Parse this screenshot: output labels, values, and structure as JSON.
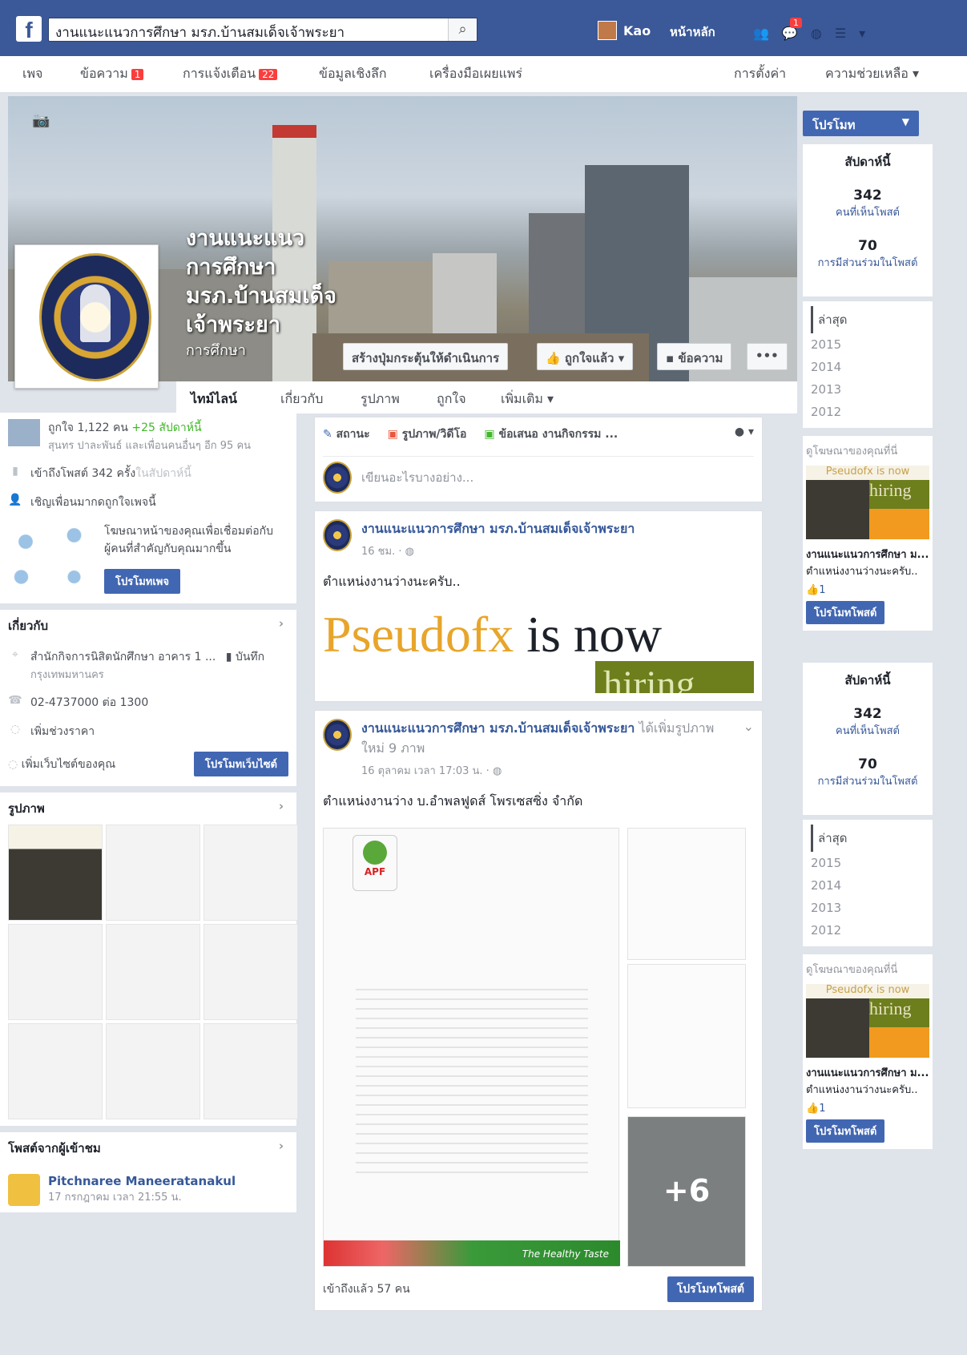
{
  "topbar": {
    "logo": "f",
    "search_value": "งานแนะแนวการศึกษา มรภ.บ้านสมเด็จเจ้าพระยา",
    "user_name": "Kao",
    "home_label": "หน้าหลัก",
    "notif_count": "1"
  },
  "pagenav": {
    "page": "เพจ",
    "messages": "ข้อความ",
    "messages_badge": "1",
    "notifications": "การแจ้งเตือน",
    "notifications_badge": "22",
    "insights": "ข้อมูลเชิงลึก",
    "publishing_tools": "เครื่องมือเผยแพร่",
    "settings": "การตั้งค่า",
    "help": "ความช่วยเหลือ ▾"
  },
  "cover": {
    "title": "งานแนะแนวการศึกษา มรภ.บ้านสมเด็จเจ้าพระยา",
    "category": "การศึกษา",
    "cta_button": "สร้างปุ่มกระตุ้นให้ดำเนินการ",
    "liked_button": "ถูกใจแล้ว ▾",
    "message_button": "ข้อความ",
    "more_button": "•••"
  },
  "covertabs": {
    "timeline": "ไทม์ไลน์",
    "about": "เกี่ยวกับ",
    "photos": "รูปภาพ",
    "likes": "ถูกใจ",
    "more": "เพิ่มเติม ▾"
  },
  "rightcol": {
    "promote": "โปรโมท",
    "stats_header": "สัปดาห์นี้",
    "reach_value": "342",
    "reach_label": "คนที่เห็นโพสต์",
    "engagement_value": "70",
    "engagement_label": "การมีส่วนร่วมในโพสต์",
    "years": [
      "ล่าสุด",
      "2015",
      "2014",
      "2013",
      "2012"
    ],
    "ad_header": "ดูโฆษณาของคุณที่นี่",
    "ad_img_top": "Pseudofx is now",
    "ad_img_hiring": "hiring",
    "ad_title": "งานแนะแนวการศึกษา ม...",
    "ad_text": "ตำแหน่งงานว่างนะครับ..",
    "ad_likes": "1",
    "ad_button": "โปรโมทโพสต์"
  },
  "leftcol": {
    "likes_text": "ถูกใจ 1,122 คน",
    "likes_delta": "+25 สัปดาห์นี้",
    "likes_friends": "สุนทร ปาละพันธ์ และเพื่อนคนอื่นๆ อีก 95 คน",
    "reach_text": "เข้าถึงโพสต์ 342 ครั้ง",
    "reach_suffix": "ในสัปดาห์นี้",
    "invite_text": "เชิญเพื่อนมากดถูกใจเพจนี้",
    "promo_text": "โฆษณาหน้าของคุณเพื่อเชื่อมต่อกับผู้คนที่สำคัญกับคุณมากขึ้น",
    "promo_button": "โปรโมทเพจ",
    "about_header": "เกี่ยวกับ",
    "address": "สำนักกิจการนิสิตนักศึกษา อาคาร 1 ...",
    "address_note": "บันทึก",
    "city": "กรุงเทพมหานคร",
    "phone": "02-4737000 ต่อ 1300",
    "add_price": "เพิ่มช่วงราคา",
    "add_website": "เพิ่มเว็บไซต์ของคุณ",
    "promote_website": "โปรโมทเว็บไซต์",
    "photos_header": "รูปภาพ",
    "visitor_header": "โพสต์จากผู้เข้าชม",
    "visitor_name": "Pitchnaree Maneeratanakul",
    "visitor_time": "17 กรกฎาคม เวลา 21:55 น."
  },
  "composer": {
    "status": "สถานะ",
    "photo_video": "รูปภาพ/วิดีโอ",
    "offer_event": "ข้อเสนอ งานกิจกรรม ...",
    "placeholder": "เขียนอะไรบางอย่าง..."
  },
  "post1": {
    "author": "งานแนะแนวการศึกษา มรภ.บ้านสมเด็จเจ้าพระยา",
    "time": "16 ชม.",
    "text": "ตำแหน่งงานว่างนะครับ..",
    "img_big_p": "Pseudofx",
    "img_big_rest": " is now",
    "img_hiring": "hiring"
  },
  "post2": {
    "author": "งานแนะแนวการศึกษา มรภ.บ้านสมเด็จเจ้าพระยา",
    "action": "ได้เพิ่มรูปภาพใหม่ 9 ภาพ",
    "time": "16 ตุลาคม เวลา 17:03 น.",
    "text": "ตำแหน่งงานว่าง บ.อำพลฟูดส์ โพรเซสซิ่ง จำกัด",
    "logo_text": "APF",
    "footer_text": "The Healthy Taste",
    "more_photos": "+6",
    "reached": "เข้าถึงแล้ว 57 คน",
    "promote_button": "โปรโมทโพสต์"
  },
  "colors": {
    "fb_blue": "#3b5998",
    "button_blue": "#4267b2",
    "link_blue": "#365899",
    "badge_red": "#fa3e3e"
  }
}
